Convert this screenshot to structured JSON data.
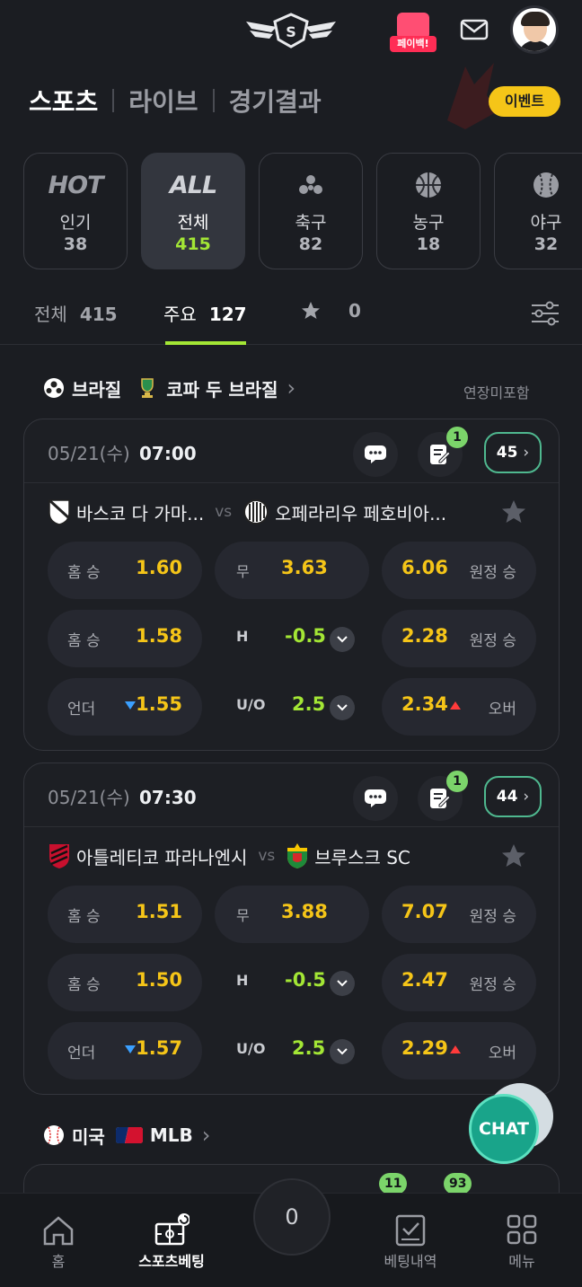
{
  "header": {
    "payback_label": "페이백!",
    "logo_icon": "winged-s-logo-icon",
    "mail_icon": "mail-icon"
  },
  "main_nav": {
    "tabs": [
      {
        "label": "스포츠",
        "active": true
      },
      {
        "label": "라이브",
        "active": false
      },
      {
        "label": "경기결과",
        "active": false
      }
    ],
    "event_label": "이벤트"
  },
  "categories": [
    {
      "icon_text": "HOT",
      "label": "인기",
      "count": "38",
      "active": false
    },
    {
      "icon_text": "ALL",
      "label": "전체",
      "count": "415",
      "active": true
    },
    {
      "icon": "soccer-ball-icon",
      "label": "축구",
      "count": "82",
      "active": false
    },
    {
      "icon": "basketball-icon",
      "label": "농구",
      "count": "18",
      "active": false
    },
    {
      "icon": "baseball-icon",
      "label": "야구",
      "count": "32",
      "active": false
    }
  ],
  "subtabs": [
    {
      "label": "전체",
      "count": "415",
      "active": false
    },
    {
      "label": "주요",
      "count": "127",
      "active": true
    },
    {
      "icon": "star-icon",
      "count": "0",
      "active": false
    }
  ],
  "league1": {
    "country": "브라질",
    "name": "코파 두 브라질",
    "note": "연장미포함"
  },
  "matches": [
    {
      "date": "05/21(수)",
      "time": "07:00",
      "edit_badge": "1",
      "more_count": "45",
      "home": "바스코 다 가마...",
      "vs": "vs",
      "away": "오페라리우 페호비아...",
      "rows": [
        {
          "left_label": "홈 승",
          "left_val": "1.60",
          "mid_label": "무",
          "mid_val": "3.63",
          "right_val": "6.06",
          "right_label": "원정 승"
        },
        {
          "left_label": "홈 승",
          "left_val": "1.58",
          "mid_label": "H",
          "mid_val": "-0.5",
          "right_val": "2.28",
          "right_label": "원정 승"
        },
        {
          "left_label": "언더",
          "left_val": "1.55",
          "mid_label": "U/O",
          "mid_val": "2.5",
          "right_val": "2.34",
          "right_label": "오버"
        }
      ]
    },
    {
      "date": "05/21(수)",
      "time": "07:30",
      "edit_badge": "1",
      "more_count": "44",
      "home": "아틀레티코 파라나엔시",
      "vs": "vs",
      "away": "브루스크 SC",
      "rows": [
        {
          "left_label": "홈 승",
          "left_val": "1.51",
          "mid_label": "무",
          "mid_val": "3.88",
          "right_val": "7.07",
          "right_label": "원정 승"
        },
        {
          "left_label": "홈 승",
          "left_val": "1.50",
          "mid_label": "H",
          "mid_val": "-0.5",
          "right_val": "2.47",
          "right_label": "원정 승"
        },
        {
          "left_label": "언더",
          "left_val": "1.57",
          "mid_label": "U/O",
          "mid_val": "2.5",
          "right_val": "2.29",
          "right_label": "오버"
        }
      ]
    }
  ],
  "league2": {
    "country": "미국",
    "name": "MLB",
    "badge_a": "11",
    "badge_b": "93"
  },
  "chat_label": "CHAT",
  "bottom_nav": {
    "items": [
      {
        "label": "홈",
        "icon": "home-icon",
        "active": false
      },
      {
        "label": "스포츠베팅",
        "icon": "stadium-icon",
        "active": true
      },
      {
        "label": "베팅내역",
        "icon": "checklist-icon",
        "active": false
      },
      {
        "label": "메뉴",
        "icon": "grid-menu-icon",
        "active": false
      }
    ],
    "betslip_count": "0"
  },
  "colors": {
    "accent_green": "#a3e635",
    "odds_yellow": "#f5c518",
    "background": "#1b1d22"
  }
}
